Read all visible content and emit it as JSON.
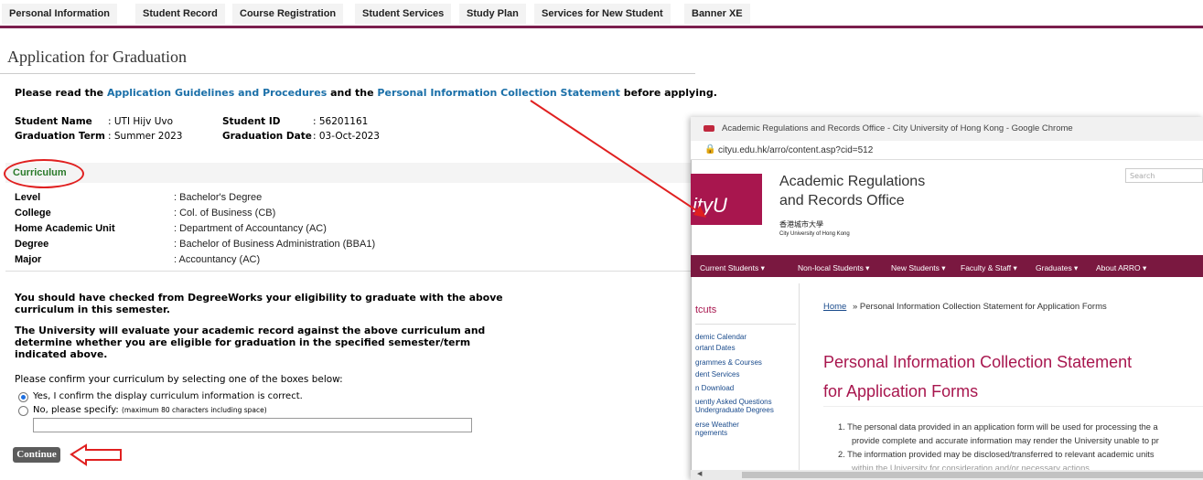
{
  "nav": {
    "tabs": [
      "Personal Information",
      "Student Record",
      "Course Registration",
      "Student Services",
      "Study Plan",
      "Services for New Student",
      "Banner XE"
    ]
  },
  "page": {
    "title": "Application for Graduation",
    "intro_pre": "Please read the ",
    "link_guidelines": "Application Guidelines and Procedures",
    "intro_mid": " and the ",
    "link_pics": "Personal Information Collection Statement",
    "intro_post": " before applying."
  },
  "student": {
    "name_label": "Student Name",
    "name_value": ": UTI Hijv Uvo",
    "id_label": "Student ID",
    "id_value": ": 56201161",
    "term_label": "Graduation Term",
    "term_value": ": Summer 2023",
    "date_label": "Graduation Date",
    "date_value": ": 03-Oct-2023"
  },
  "curriculum": {
    "title": "Curriculum",
    "rows": [
      {
        "label": "Level",
        "value": ": Bachelor's Degree"
      },
      {
        "label": "College",
        "value": ": Col. of Business (CB)"
      },
      {
        "label": "Home Academic Unit",
        "value": ": Department of Accountancy (AC)"
      },
      {
        "label": "Degree",
        "value": ": Bachelor of Business Administration (BBA1)"
      },
      {
        "label": "Major",
        "value": ": Accountancy (AC)"
      }
    ]
  },
  "notice": {
    "p1": "You should have checked from DegreeWorks your eligibility to graduate with the above curriculum in this semester.",
    "p2": "The University will evaluate your academic record against the above curriculum and determine whether you are eligible for graduation in the specified semester/term indicated above.",
    "confirm_prompt": "Please confirm your curriculum by selecting one of the boxes below:",
    "option_yes": "Yes, I confirm the display curriculum information is correct.",
    "option_no": "No, please specify:",
    "option_no_hint": "(maximum 80 characters including space)",
    "specify_value": "",
    "continue_label": "Continue"
  },
  "browser": {
    "window_title": "Academic Regulations and Records Office - City University of Hong Kong - Google Chrome",
    "url": "cityu.edu.hk/arro/content.asp?cid=512",
    "search_placeholder": "Search",
    "logo_text": "ityU",
    "org_line1": "Academic Regulations",
    "org_line2": "and Records Office",
    "org_chinese": "香港城市大學",
    "org_english": "City University of Hong Kong",
    "nav_items": [
      "Current Students ▾",
      "Non-local Students ▾",
      "New Students ▾",
      "Faculty & Staff ▾",
      "Graduates ▾",
      "About ARRO ▾"
    ],
    "sidebar_head": "tcuts",
    "sidebar_items": [
      "demic Calendar",
      "ortant Dates",
      "grammes & Courses",
      "dent Services",
      "n Download",
      "uently Asked Questions",
      "Undergraduate Degrees",
      "erse Weather",
      "ngements"
    ],
    "crumb_home": "Home",
    "crumb_rest": "» Personal Information Collection Statement for Application Forms",
    "heading_line1": "Personal Information Collection Statement",
    "heading_line2": "for Application Forms",
    "items": [
      "1.  The personal data provided in an application form will be used for processing the a",
      "provide complete and accurate information may render the University unable to pr",
      "2.  The information provided may be disclosed/transferred to relevant academic units",
      "within the University for consideration and/or necessary actions."
    ]
  },
  "colors": {
    "brand": "#a8164e",
    "nav_rule": "#7b1e4d",
    "link": "#1a6fa8",
    "annotation": "#e02020"
  }
}
